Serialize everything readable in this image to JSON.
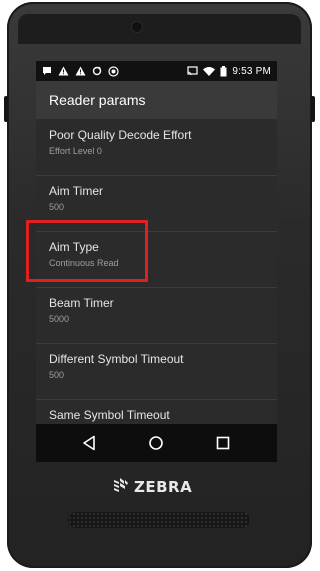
{
  "status_bar": {
    "time": "9:53 PM",
    "left_icons": [
      "chat-bubble-icon",
      "warning-icon",
      "warning-icon",
      "sync-icon",
      "target-icon"
    ],
    "right_icons": [
      "cast-icon",
      "wifi-icon",
      "battery-icon"
    ]
  },
  "app": {
    "title": "Reader params"
  },
  "items": [
    {
      "title": "Poor Quality Decode Effort",
      "subtitle": "Effort Level 0"
    },
    {
      "title": "Aim Timer",
      "subtitle": "500"
    },
    {
      "title": "Aim Type",
      "subtitle": "Continuous Read"
    },
    {
      "title": "Beam Timer",
      "subtitle": "5000"
    },
    {
      "title": "Different Symbol Timeout",
      "subtitle": "500"
    },
    {
      "title": "Same Symbol Timeout",
      "subtitle": ""
    }
  ],
  "nav": {
    "back": "back-icon",
    "home": "home-icon",
    "recents": "recents-icon"
  },
  "brand": {
    "name": "ZEBRA"
  },
  "colors": {
    "highlight": "#e02020",
    "appbar": "#3a3a3a",
    "list_bg": "#2b2b2b"
  }
}
